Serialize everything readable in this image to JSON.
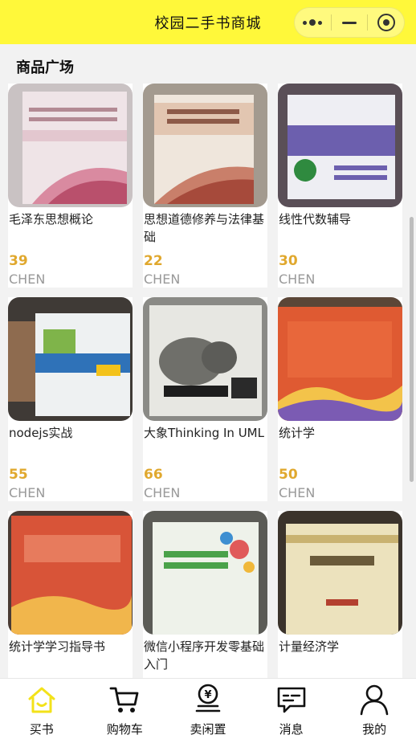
{
  "header": {
    "title": "校园二手书商城"
  },
  "section": {
    "title": "商品广场"
  },
  "products": [
    {
      "name": "毛泽东思想概论",
      "price": "39",
      "seller": "CHEN",
      "cover_color": "#d9c9c4"
    },
    {
      "name": "思想道德修养与法律基础",
      "price": "22",
      "seller": "CHEN",
      "cover_color": "#d9b8a6"
    },
    {
      "name": "线性代数辅导",
      "price": "30",
      "seller": "CHEN",
      "cover_color": "#9a8cc4"
    },
    {
      "name": "nodejs实战",
      "price": "55",
      "seller": "CHEN",
      "cover_color": "#6d5a4b"
    },
    {
      "name": "大象Thinking In UML",
      "price": "66",
      "seller": "CHEN",
      "cover_color": "#cfcfc7"
    },
    {
      "name": "统计学",
      "price": "50",
      "seller": "CHEN",
      "cover_color": "#e06a3c"
    },
    {
      "name": "统计学学习指导书",
      "price": "",
      "seller": "",
      "cover_color": "#d8553a"
    },
    {
      "name": "微信小程序开发零基础入门",
      "price": "",
      "seller": "",
      "cover_color": "#e9eee4"
    },
    {
      "name": "计量经济学",
      "price": "",
      "seller": "",
      "cover_color": "#e7dcb6"
    }
  ],
  "tabs": [
    {
      "label": "买书",
      "icon": "home-icon",
      "active": true
    },
    {
      "label": "购物车",
      "icon": "cart-icon",
      "active": false
    },
    {
      "label": "卖闲置",
      "icon": "sell-icon",
      "active": false
    },
    {
      "label": "消息",
      "icon": "message-icon",
      "active": false
    },
    {
      "label": "我的",
      "icon": "user-icon",
      "active": false
    }
  ],
  "colors": {
    "brand": "#fff83a",
    "price": "#e0a82e",
    "seller": "#999999",
    "active_tab": "#f3e21a"
  }
}
